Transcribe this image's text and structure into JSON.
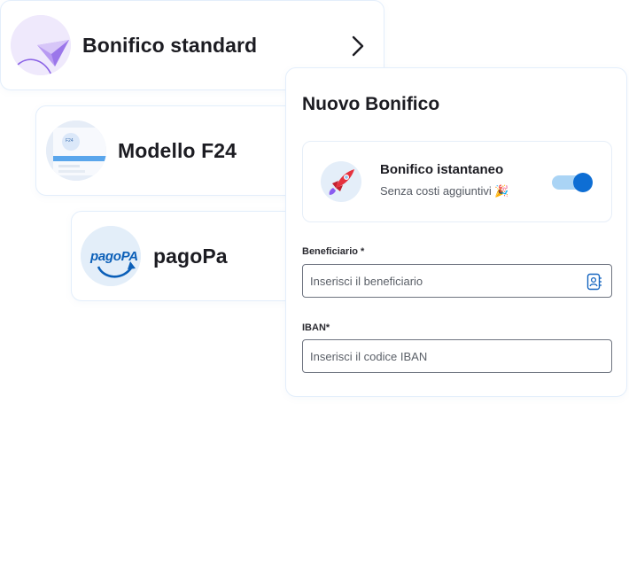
{
  "payment_options": [
    {
      "label": "Bonifico standard"
    },
    {
      "label": "Modello F24",
      "thumb_text": "F24"
    },
    {
      "label": "pagoPa",
      "logo_text": "pagoPA"
    }
  ],
  "panel": {
    "title": "Nuovo Bonifico",
    "instant": {
      "title": "Bonifico istantaneo",
      "subtitle": "Senza costi aggiuntivi 🎉",
      "toggle_on": true
    },
    "fields": [
      {
        "label": "Beneficiario *",
        "placeholder": "Inserisci il beneficiario",
        "value": ""
      },
      {
        "label": "IBAN*",
        "placeholder": "Inserisci il codice IBAN",
        "value": ""
      }
    ]
  },
  "colors": {
    "accent": "#0e6ed4",
    "toggle_track": "#aad4f5",
    "card_border": "#e3eefb",
    "avatar_purple": "#ece4fb"
  },
  "icons": [
    "paper-plane-icon",
    "chevron-right-icon",
    "rocket-icon",
    "contact-book-icon"
  ]
}
